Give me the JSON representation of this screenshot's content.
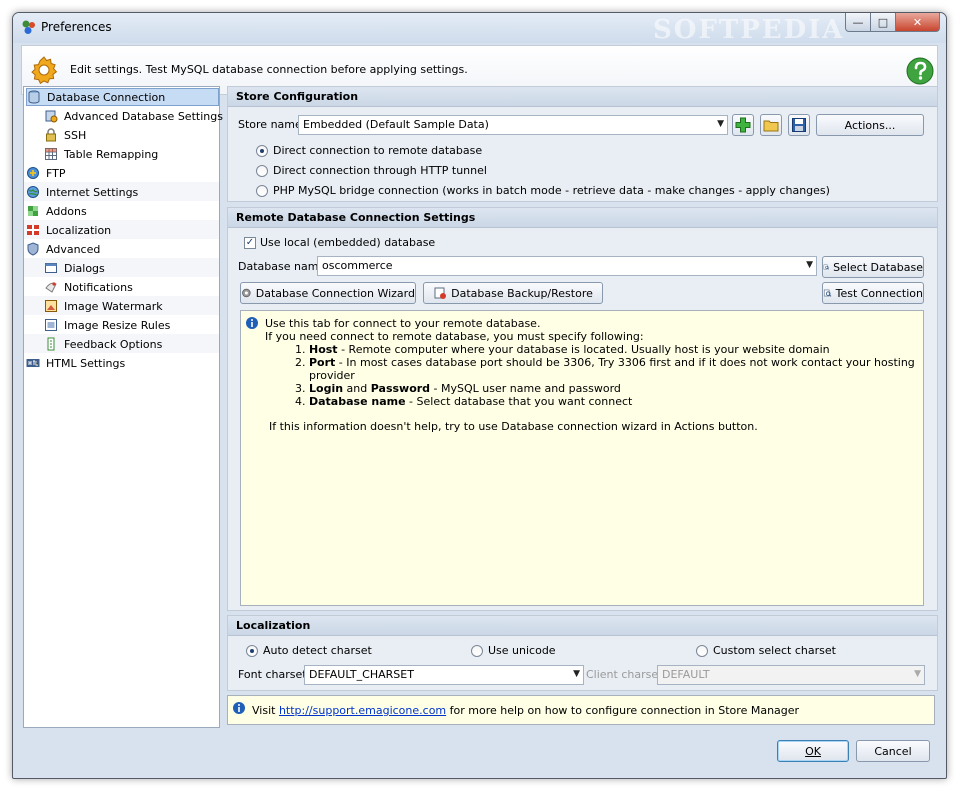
{
  "window": {
    "title": "Preferences",
    "watermark": "SOFTPEDIA"
  },
  "header": {
    "text": "Edit settings. Test MySQL database connection before applying settings."
  },
  "tree": [
    {
      "label": "Database Connection",
      "icon": "database-icon",
      "selected": true
    },
    {
      "label": "Advanced Database Settings",
      "icon": "database-settings-icon"
    },
    {
      "label": "SSH",
      "icon": "lock-icon"
    },
    {
      "label": "Table Remapping",
      "icon": "table-icon"
    },
    {
      "label": "FTP",
      "icon": "ftp-icon"
    },
    {
      "label": "Internet Settings",
      "icon": "globe-icon"
    },
    {
      "label": "Addons",
      "icon": "puzzle-icon"
    },
    {
      "label": "Localization",
      "icon": "flag-icon"
    },
    {
      "label": "Advanced",
      "icon": "shield-icon"
    },
    {
      "label": "Dialogs",
      "icon": "dialog-icon"
    },
    {
      "label": "Notifications",
      "icon": "notification-icon"
    },
    {
      "label": "Image Watermark",
      "icon": "image-watermark-icon"
    },
    {
      "label": "Image Resize Rules",
      "icon": "image-resize-icon"
    },
    {
      "label": "Feedback Options",
      "icon": "feedback-icon"
    },
    {
      "label": "HTML Settings",
      "icon": "html-icon"
    }
  ],
  "store": {
    "title": "Store Configuration",
    "name_label": "Store name",
    "name_value": "Embedded (Default Sample Data)",
    "actions_label": "Actions...",
    "radios": [
      {
        "label": "Direct connection to remote database",
        "checked": true
      },
      {
        "label": "Direct connection through HTTP tunnel",
        "checked": false
      },
      {
        "label": "PHP MySQL bridge connection (works in batch mode - retrieve data - make changes - apply changes)",
        "checked": false
      }
    ]
  },
  "remote": {
    "title": "Remote Database Connection Settings",
    "use_local_label": "Use local (embedded) database",
    "use_local_checked": true,
    "dbname_label": "Database name",
    "dbname_value": "oscommerce",
    "select_db_label": "Select Database",
    "wizard_label": "Database Connection Wizard",
    "backup_label": "Database Backup/Restore",
    "test_label": "Test Connection",
    "info": {
      "line1": "Use this tab for connect to your remote database.",
      "line2": "If you need connect to remote database, you must specify following:",
      "items": [
        {
          "bold": "Host",
          "mid": "",
          "bold2": "",
          "rest": " - Remote computer where your database is located. Usually host is your website domain"
        },
        {
          "bold": "Port",
          "mid": "",
          "bold2": "",
          "rest": " - In most cases database port should be 3306, Try 3306 first and if it does not work contact your hosting provider"
        },
        {
          "bold": "Login",
          "mid": " and ",
          "bold2": "Password",
          "rest": " - MySQL user name and password"
        },
        {
          "bold": "Database name",
          "mid": "",
          "bold2": "",
          "rest": " - Select database that you want connect"
        }
      ],
      "footer": "If this information doesn't help, try to use Database connection wizard in Actions button."
    }
  },
  "localization": {
    "title": "Localization",
    "radios": [
      {
        "label": "Auto detect charset",
        "checked": true
      },
      {
        "label": "Use unicode",
        "checked": false
      },
      {
        "label": "Custom select charset",
        "checked": false
      }
    ],
    "font_charset_label": "Font charset",
    "font_charset_value": "DEFAULT_CHARSET",
    "client_charset_label": "Client charset",
    "client_charset_value": "DEFAULT"
  },
  "footer": {
    "prefix": "Visit ",
    "link": "http://support.emagicone.com",
    "suffix": " for more help on how to configure connection in Store Manager"
  },
  "buttons": {
    "ok": "OK",
    "cancel": "Cancel"
  }
}
